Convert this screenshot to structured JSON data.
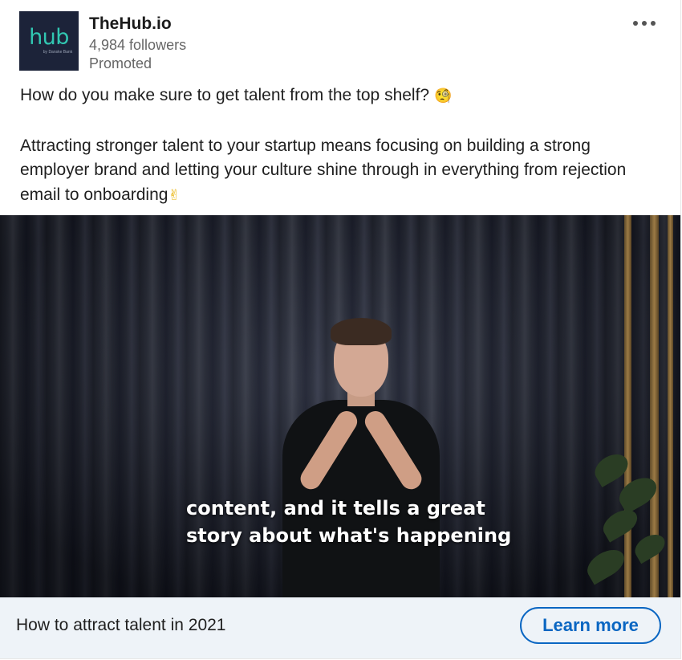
{
  "company": {
    "logo_text": "hub",
    "logo_subtext": "by Danske Bank",
    "name": "TheHub.io",
    "followers": "4,984 followers",
    "label": "Promoted"
  },
  "post": {
    "line1": "How do you make sure to get talent from the top shelf?",
    "line1_emoji": "🧐",
    "paragraph2": "Attracting stronger talent to your startup means focusing on building a strong employer brand and letting your culture shine through in everything from rejection email to onboarding",
    "paragraph2_emoji": "✌"
  },
  "video": {
    "caption_line1": "content, and it tells a great",
    "caption_line2": "story about what's happening"
  },
  "cta": {
    "title": "How to attract talent in 2021",
    "button_label": "Learn more"
  },
  "icons": {
    "more": "more-horizontal-icon"
  },
  "colors": {
    "accent": "#0a66c2",
    "logo_bg": "#1c2339",
    "logo_text": "#31c6b1",
    "cta_bg": "#eef3f8"
  }
}
